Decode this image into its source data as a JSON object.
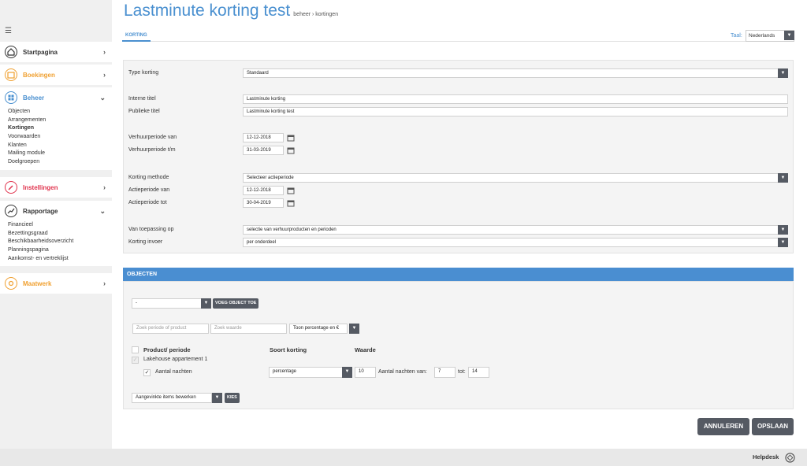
{
  "header": {
    "title": "Lastminute korting test",
    "breadcrumb": "beheer › kortingen",
    "tab": "KORTING",
    "lang_label": "Taal:",
    "lang_value": "Nederlands"
  },
  "sidebar": {
    "groups": [
      {
        "label": "Startpagina",
        "color": "#333333",
        "icon": "home-icon"
      },
      {
        "label": "Boekingen",
        "color": "#f0a030",
        "icon": "calendar-icon"
      },
      {
        "label": "Beheer",
        "color": "#4a90d0",
        "icon": "grid-icon",
        "items": [
          "Objecten",
          "Arrangementen",
          "Kortingen",
          "Voorwaarden",
          "Klanten",
          "Mailing module",
          "Doelgroepen"
        ]
      },
      {
        "label": "Instellingen",
        "color": "#e0334d",
        "icon": "wrench-icon"
      },
      {
        "label": "Rapportage",
        "color": "#333333",
        "icon": "chart-icon",
        "items": [
          "Financieel",
          "Bezettingsgraad",
          "Beschikbaarheidsoverzicht",
          "Planningspagina",
          "Aankomst- en vertreklijst"
        ]
      },
      {
        "label": "Maatwerk",
        "color": "#f0a030",
        "icon": "puzzle-icon"
      }
    ]
  },
  "form": {
    "type_korting": {
      "label": "Type korting",
      "value": "Standaard"
    },
    "interne_titel": {
      "label": "Interne titel",
      "value": "Lastminute korting"
    },
    "publieke_titel": {
      "label": "Publieke titel",
      "value": "Lastminute korting test"
    },
    "verhuur_van": {
      "label": "Verhuurperiode van",
      "value": "12-12-2018"
    },
    "verhuur_tm": {
      "label": "Verhuurperiode t/m",
      "value": "31-03-2019"
    },
    "korting_methode": {
      "label": "Korting methode",
      "value": "Selecteer actieperiode"
    },
    "actie_van": {
      "label": "Actieperiode van",
      "value": "12-12-2018"
    },
    "actie_tot": {
      "label": "Actieperiode tot",
      "value": "30-04-2019"
    },
    "toepassing": {
      "label": "Van toepassing op",
      "value": "selectie van verhuurproducten en perioden"
    },
    "invoer": {
      "label": "Korting invoer",
      "value": "per onderdeel"
    }
  },
  "objecten": {
    "title": "OBJECTEN",
    "object_select": "-",
    "add_button": "VOEG OBJECT TOE",
    "search_period_placeholder": "Zoek periode of product",
    "search_value_placeholder": "Zoek waarde",
    "show_select": "Toon percentage en €",
    "col_product": "Product/ periode",
    "col_soort": "Soort korting",
    "col_waarde": "Waarde",
    "row_product": "Lakehouse appartement 1",
    "row_sub": "Aantal nachten",
    "row_soort": "percentage",
    "row_waarde": "10",
    "nachten_van_label": "Aantal nachten van:",
    "nachten_van": "7",
    "tot_label": "tot:",
    "tot_value": "14",
    "bulk_select": "Aangevinkte items bewerken",
    "kies_button": "KIES"
  },
  "actions": {
    "cancel": "ANNULEREN",
    "save": "OPSLAAN"
  },
  "footer": {
    "helpdesk": "Helpdesk"
  }
}
